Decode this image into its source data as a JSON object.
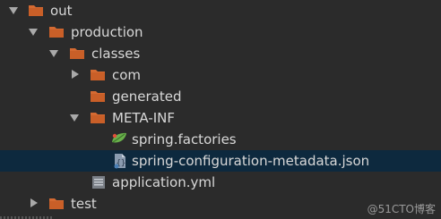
{
  "tree": {
    "items": [
      {
        "label": "out",
        "expanded": true,
        "icon": "folder-icon"
      },
      {
        "label": "production",
        "expanded": true,
        "icon": "folder-icon"
      },
      {
        "label": "classes",
        "expanded": true,
        "icon": "folder-icon"
      },
      {
        "label": "com",
        "expanded": false,
        "icon": "folder-icon"
      },
      {
        "label": "generated",
        "icon": "folder-icon"
      },
      {
        "label": "META-INF",
        "expanded": true,
        "icon": "folder-icon"
      },
      {
        "label": "spring.factories",
        "icon": "spring-leaf-icon"
      },
      {
        "label": "spring-configuration-metadata.json",
        "icon": "json-file-icon",
        "selected": true
      },
      {
        "label": "application.yml",
        "icon": "yml-file-icon"
      },
      {
        "label": "test",
        "expanded": false,
        "icon": "folder-icon"
      }
    ]
  },
  "watermark": "@51CTO博客",
  "colors": {
    "background": "#2b2b2b",
    "selection": "#0d293e",
    "folder": "#d46a32",
    "text": "#d8d8d8",
    "spring": "#6ab04c"
  }
}
